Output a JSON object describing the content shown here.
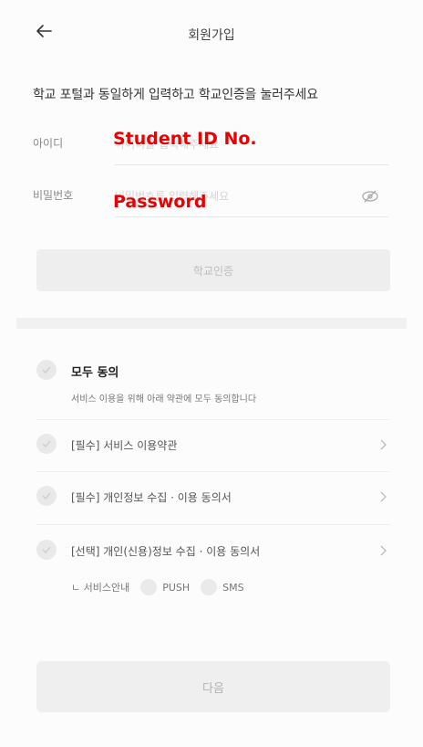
{
  "header": {
    "title": "회원가입",
    "back_icon": "arrow-left-icon"
  },
  "instruction": "학교 포털과 동일하게 입력하고 학교인증을 눌러주세요",
  "id_field": {
    "label": "아이디",
    "placeholder": "아이디를 입력해주세요",
    "overlay": "Student ID No."
  },
  "password_field": {
    "label": "비밀번호",
    "placeholder": "비밀번호를 입력해주세요",
    "overlay": "Password",
    "eye_icon": "eye-slash-icon"
  },
  "verify_button": "학교인증",
  "agreements": {
    "all": {
      "label": "모두 동의",
      "description": "서비스 이용을 위해 아래 약관에 모두 동의합니다"
    },
    "items": [
      {
        "label": "[필수] 서비스 이용약관"
      },
      {
        "label": "[필수] 개인정보 수집 · 이용 동의서"
      },
      {
        "label": "[선택] 개인(신용)정보 수집 · 이용 동의서"
      }
    ],
    "service_notice": {
      "label": "ㄴ 서비스안내",
      "options": [
        "PUSH",
        "SMS"
      ]
    }
  },
  "next_button": "다음",
  "colors": {
    "overlay_red": "#ea0000",
    "check_gray": "#e9e9e9",
    "button_gray": "#eeeeee"
  }
}
